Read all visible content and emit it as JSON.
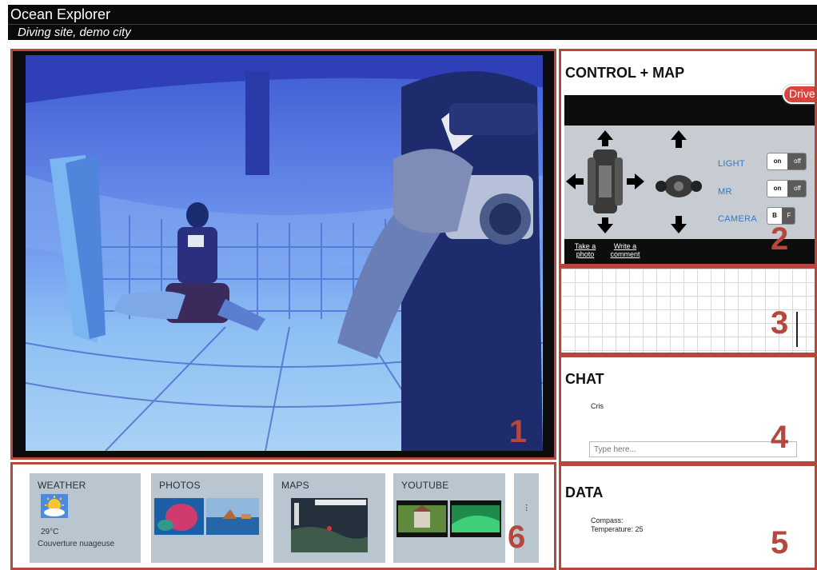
{
  "header": {
    "app_title": "Ocean Explorer",
    "subtitle": "Diving site, demo city"
  },
  "panel_numbers": {
    "video": "1",
    "control": "2",
    "grid": "3",
    "chat": "4",
    "data": "5",
    "widgets": "6"
  },
  "control": {
    "title": "CONTROL + MAP",
    "driver_button": "Driver",
    "toggles": [
      {
        "label": "LIGHT",
        "on": "on",
        "off": "off"
      },
      {
        "label": "MR",
        "on": "on",
        "off": "off"
      },
      {
        "label": "CAMERA",
        "on": "B",
        "off": "F"
      }
    ],
    "actions": {
      "take_photo": "Take a photo",
      "write_comment": "Write a comment"
    }
  },
  "chat": {
    "title": "CHAT",
    "user": "Cris",
    "placeholder": "Type here..."
  },
  "data_panel": {
    "title": "DATA",
    "compass": "Compass:",
    "temperature": "Temperature: 25"
  },
  "widgets": {
    "weather": {
      "title": "WEATHER",
      "temp": "29°C",
      "condition": "Couverture nuageuse",
      "icon": "partly-cloudy-sun-icon"
    },
    "photos": {
      "title": "PHOTOS"
    },
    "maps": {
      "title": "MAPS"
    },
    "youtube": {
      "title": "YOUTUBE"
    },
    "more": "..."
  },
  "colors": {
    "frame": "#b5473c",
    "tile": "#b9c6cf",
    "accent_blue": "#2f79c8",
    "driver": "#d9443c"
  }
}
